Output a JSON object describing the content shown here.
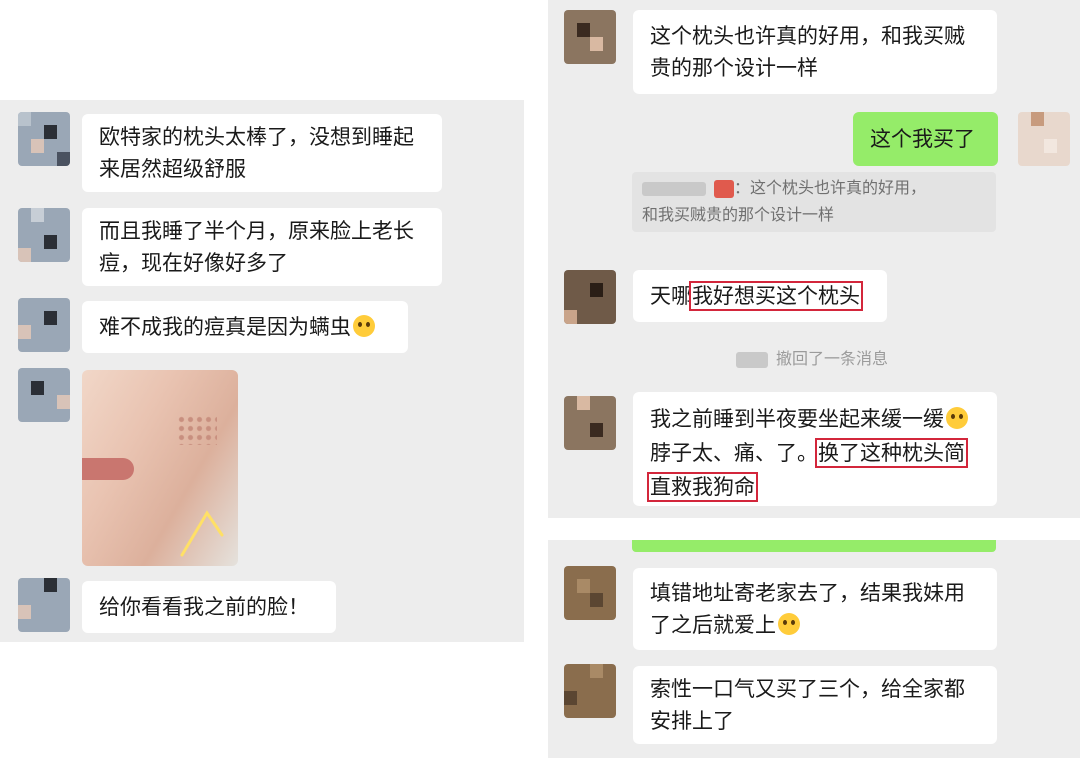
{
  "left_chat": {
    "messages": [
      {
        "lines": [
          "欧特家的枕头太棒了，没想到睡起",
          "来居然超级舒服"
        ]
      },
      {
        "lines": [
          "而且我睡了半个月，原来脸上老长",
          "痘，现在好像好多了"
        ]
      },
      {
        "lines": [
          "难不成我的痘真是因为螨虫"
        ],
        "emoji": "screaming-face-emoji"
      },
      {
        "type": "photo",
        "icon": "face-photo-with-arrow"
      },
      {
        "lines": [
          "给你看看我之前的脸！"
        ]
      }
    ]
  },
  "right_chat": {
    "top": [
      {
        "lines": [
          "这个枕头也许真的好用，和我买贼",
          "贵的那个设计一样"
        ]
      },
      {
        "self": true,
        "lines": [
          "这个我买了"
        ]
      },
      {
        "quote_lines": [
          "：这个枕头也许真的好用，",
          "和我买贼贵的那个设计一样"
        ]
      },
      {
        "prefix": "天哪",
        "highlight": "我好想买这个枕头"
      },
      {
        "system": "撤回了一条消息"
      },
      {
        "line1": "我之前睡到半夜要坐起来缓一缓",
        "line2_plain": "脖子太、痛、了。",
        "line2_highlight": "换了这种枕头简",
        "line3_highlight": "直救我狗命"
      }
    ],
    "bottom": [
      {
        "lines": [
          "填错地址寄老家去了，结果我妹用",
          "了之后就爱上"
        ],
        "emoji": "crying-laughing-emoji"
      },
      {
        "lines": [
          "索性一口气又买了三个，给全家都",
          "安排上了"
        ]
      }
    ]
  },
  "colors": {
    "panel_bg": "#ededed",
    "bubble": "#ffffff",
    "self_bubble": "#95ec69",
    "highlight_box": "#d3263b"
  }
}
